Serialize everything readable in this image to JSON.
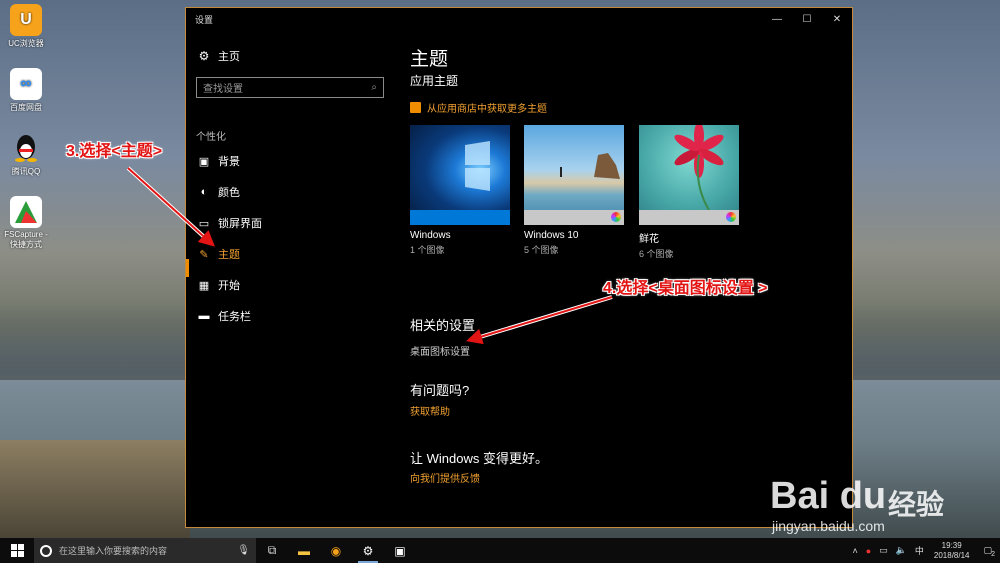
{
  "desktop": {
    "icons": [
      {
        "label": "UC浏览器",
        "icon": "uc-browser-icon",
        "color": "#f7a21b"
      },
      {
        "label": "百度网盘",
        "icon": "baidu-netdisk-icon",
        "color": "#2e8ff2"
      },
      {
        "label": "腾讯QQ",
        "icon": "qq-icon",
        "color": "#1a1a1a"
      },
      {
        "label": "FSCapture - 快捷方式",
        "icon": "fscapture-icon",
        "color": "#2a9d3a"
      }
    ]
  },
  "window": {
    "title": "设置",
    "controls": [
      "—",
      "☐",
      "✕"
    ]
  },
  "sidebar": {
    "home_label": "主页",
    "search_placeholder": "查找设置",
    "section_label": "个性化",
    "items": [
      {
        "label": "背景",
        "icon": "picture-icon"
      },
      {
        "label": "颜色",
        "icon": "palette-icon"
      },
      {
        "label": "锁屏界面",
        "icon": "lockscreen-icon"
      },
      {
        "label": "主题",
        "icon": "theme-icon",
        "active": true
      },
      {
        "label": "开始",
        "icon": "start-icon"
      },
      {
        "label": "任务栏",
        "icon": "taskbar-icon"
      }
    ]
  },
  "main": {
    "title": "主题",
    "subtitle": "应用主题",
    "store_link": "从应用商店中获取更多主题",
    "themes": [
      {
        "name": "Windows",
        "count": "1 个图像",
        "bar_color": "#0078d7"
      },
      {
        "name": "Windows 10",
        "count": "5 个图像",
        "bar_color": "#c8c8c8"
      },
      {
        "name": "鲜花",
        "count": "6 个图像",
        "bar_color": "#c8c8c8"
      }
    ],
    "related_heading": "相关的设置",
    "related_link": "桌面图标设置",
    "question_heading": "有问题吗?",
    "help_link": "获取帮助",
    "improve_heading": "让 Windows 变得更好。",
    "feedback_link": "向我们提供反馈"
  },
  "annotations": {
    "step3": "3.选择<主题>",
    "step4": "4.选择<桌面图标设置 >"
  },
  "watermark": {
    "logo": "Bai du",
    "cn": "经验",
    "url": "jingyan.baidu.com"
  },
  "taskbar": {
    "search_placeholder": "在这里输入你要搜索的内容",
    "ime": "中",
    "time": "19:39",
    "date": "2018/8/14",
    "notification_count": "2"
  },
  "colors": {
    "accent": "#f08c00",
    "annotation": "#e31414"
  }
}
